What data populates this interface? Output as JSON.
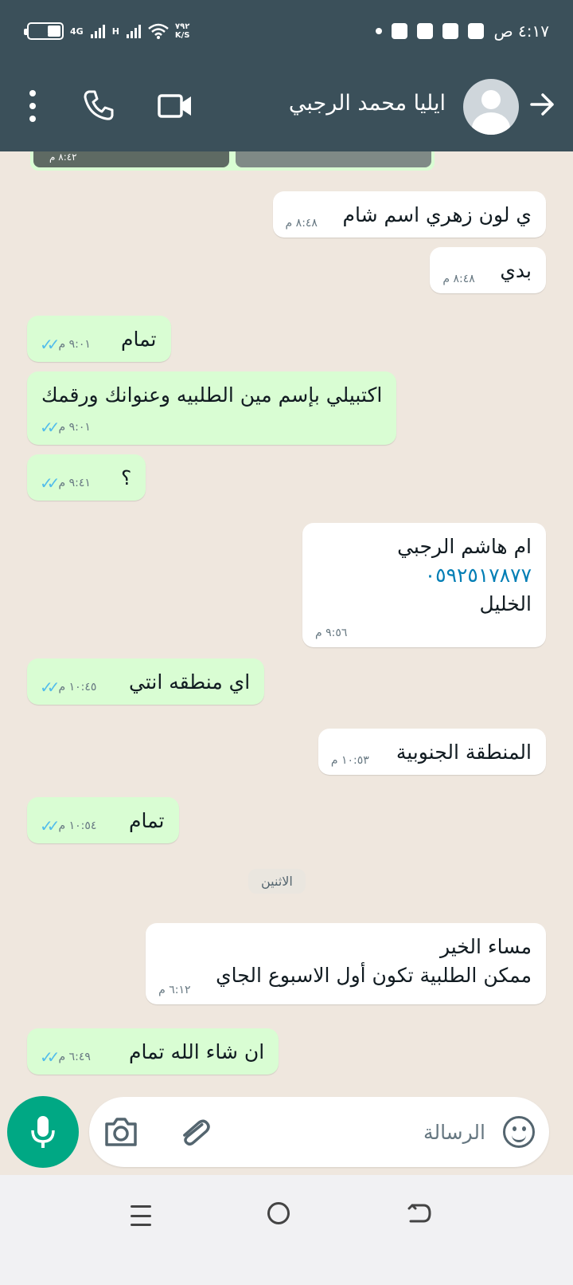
{
  "status_bar": {
    "time": "٤:١٧ ص",
    "battery": "٣٨",
    "network_1": "4G",
    "network_2": "H",
    "speed_value": "٧٩٢",
    "speed_unit": "K/S"
  },
  "header": {
    "contact_name": "ايليا محمد الرجبي"
  },
  "chat": {
    "top_media_time": "٨:٤٢ م",
    "date_separator": "الاثنين",
    "messages": [
      {
        "dir": "in",
        "lines": [
          "ي لون زهري اسم شام"
        ],
        "time": "٨:٤٨ م"
      },
      {
        "dir": "in",
        "lines": [
          "بدي"
        ],
        "time": "٨:٤٨ م"
      },
      {
        "dir": "out",
        "lines": [
          "تمام"
        ],
        "time": "٩:٠١ م"
      },
      {
        "dir": "out",
        "lines": [
          "اكتبيلي بإسم مين الطلبيه وعنوانك ورقمك"
        ],
        "time": "٩:٠١ م"
      },
      {
        "dir": "out",
        "lines": [
          "؟"
        ],
        "time": "٩:٤١ م"
      },
      {
        "dir": "in",
        "lines": [
          "ام هاشم الرجبي",
          "٠٥٩٢٥١٧٨٧٧",
          "الخليل"
        ],
        "time": "٩:٥٦ م"
      },
      {
        "dir": "out",
        "lines": [
          "اي منطقه انتي"
        ],
        "time": "١٠:٤٥ م"
      },
      {
        "dir": "in",
        "lines": [
          "المنطقة الجنوبية"
        ],
        "time": "١٠:٥٣ م"
      },
      {
        "dir": "out",
        "lines": [
          "تمام"
        ],
        "time": "١٠:٥٤ م"
      },
      {
        "dir": "in",
        "lines": [
          "مساء الخير",
          "ممكن الطلبية تكون أول الاسبوع الجاي"
        ],
        "time": "٦:١٢ م"
      },
      {
        "dir": "out",
        "lines": [
          "ان شاء الله تمام"
        ],
        "time": "٦:٤٩ م"
      }
    ]
  },
  "composer": {
    "placeholder": "الرسالة"
  },
  "colors": {
    "header_bg": "#3b505a",
    "outgoing_bubble": "#d9fdd3",
    "incoming_bubble": "#ffffff",
    "accent": "#00a884",
    "read_ticks": "#53bdeb",
    "link": "#027eb5"
  }
}
